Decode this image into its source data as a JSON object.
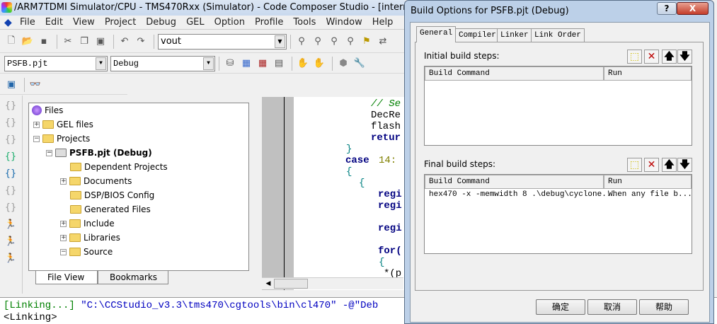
{
  "window": {
    "title": "/ARM7TDMI Simulator/CPU - TMS470Rxx (Simulator) - Code Composer Studio - [interrupts.c]"
  },
  "menu": [
    "File",
    "Edit",
    "View",
    "Project",
    "Debug",
    "GEL",
    "Option",
    "Profile",
    "Tools",
    "Window",
    "Help"
  ],
  "toolbar": {
    "search_value": "vout",
    "project_select": "PSFB.pjt",
    "config_select": "Debug"
  },
  "tree": {
    "root": "Files",
    "items": [
      "GEL files",
      "Projects",
      "PSFB.pjt (Debug)",
      "Dependent Projects",
      "Documents",
      "DSP/BIOS Config",
      "Generated Files",
      "Include",
      "Libraries",
      "Source"
    ],
    "tabs": [
      "File View",
      "Bookmarks"
    ]
  },
  "editor": {
    "lines": [
      "// Se",
      "DecRe",
      "flash",
      "retur",
      "}",
      "case",
      "14:",
      "{",
      "{",
      "regi",
      "regi",
      "regi",
      "for(",
      "{",
      "*(p"
    ]
  },
  "output": {
    "line1_tag": "[Linking...]",
    "line1_cmd": "\"C:\\CCStudio_v3.3\\tms470\\cgtools\\bin\\cl470\" -@\"Deb",
    "line2": "<Linking>"
  },
  "dialog": {
    "title": "Build Options for PSFB.pjt (Debug)",
    "help": "?",
    "close": "X",
    "tabs": [
      "General",
      "Compiler",
      "Linker",
      "Link Order"
    ],
    "initial_label": "Initial build steps:",
    "final_label": "Final build steps:",
    "col_command": "Build Command",
    "col_run": "Run",
    "final_rows": [
      {
        "command": "hex470 -x -memwidth 8 .\\debug\\cyclone...",
        "run": "When any file b..."
      }
    ],
    "buttons": {
      "ok": "确定",
      "cancel": "取消",
      "help": "帮助"
    }
  }
}
